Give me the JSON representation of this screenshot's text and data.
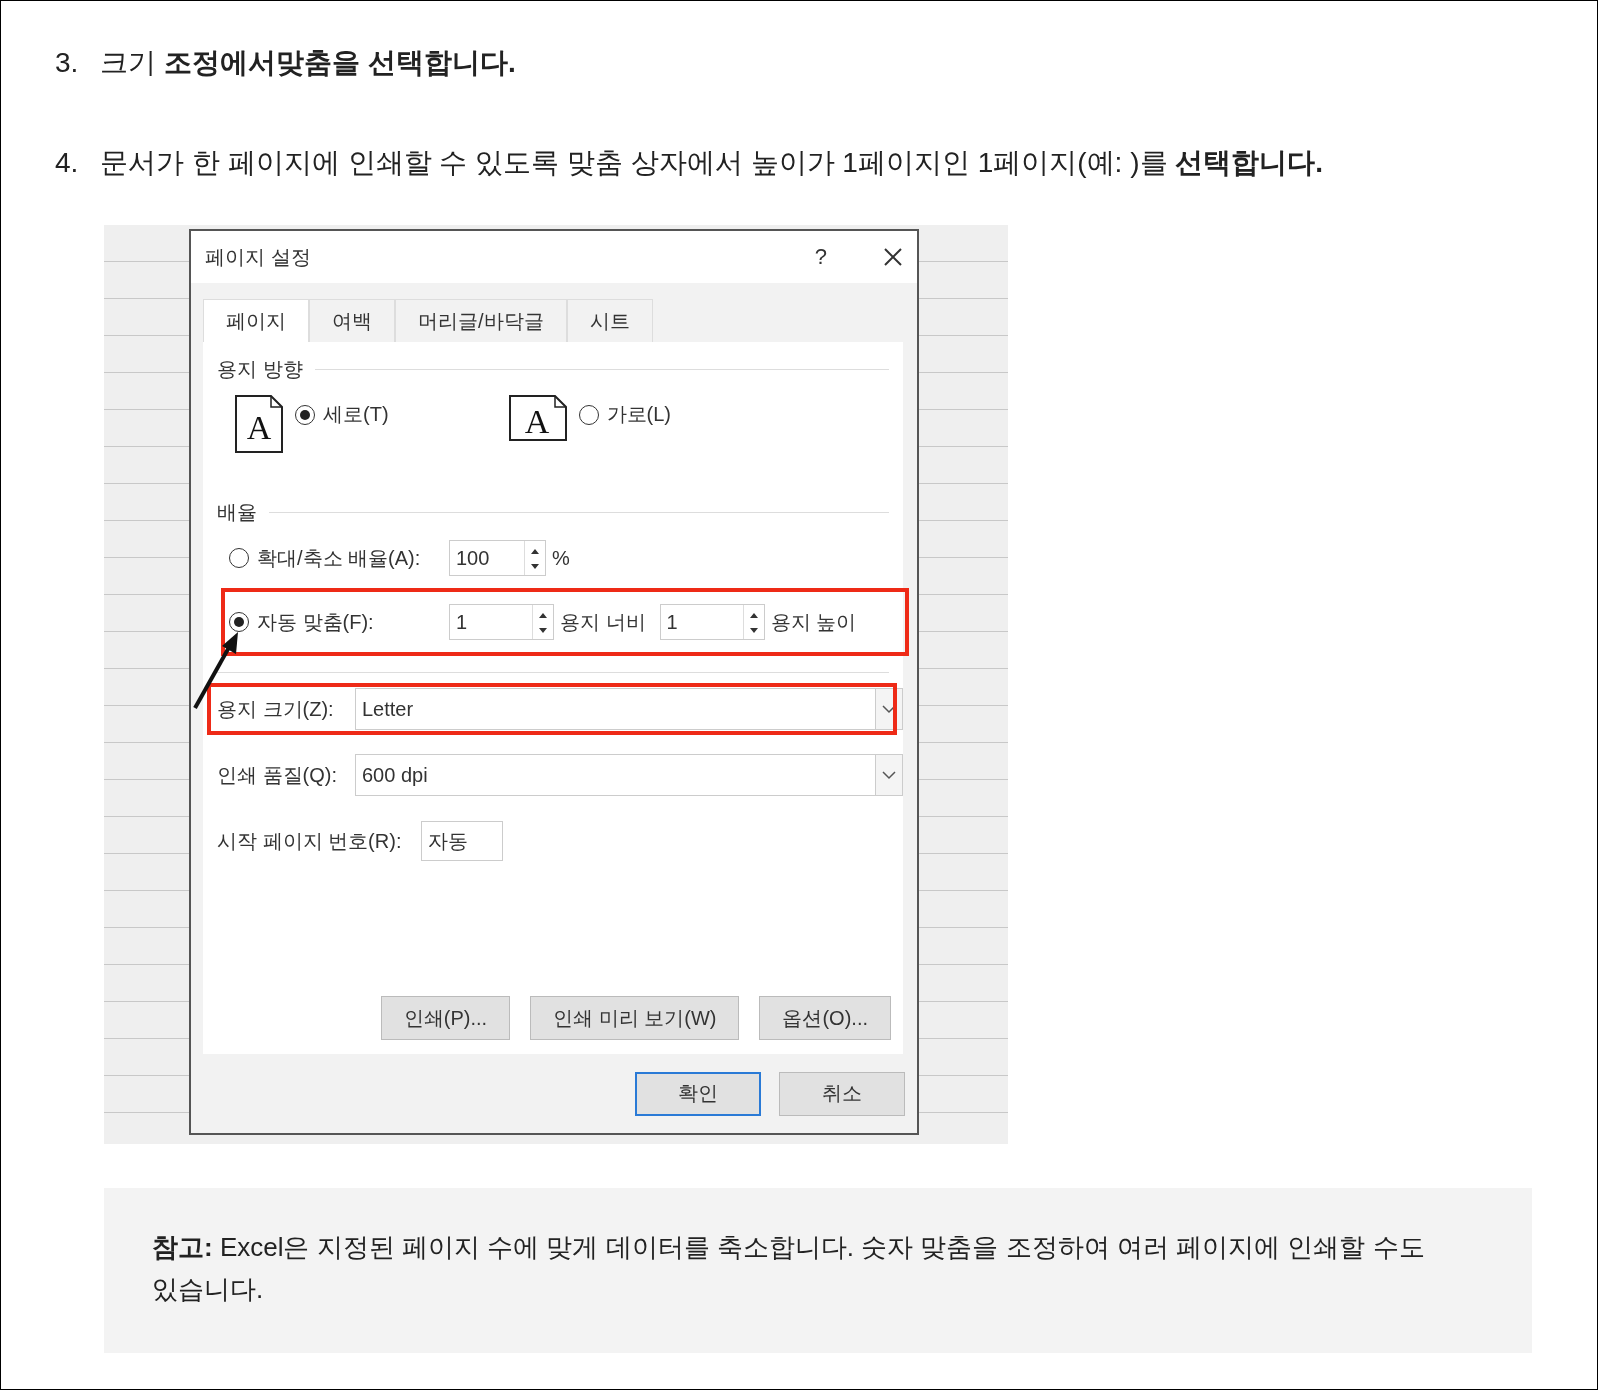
{
  "steps": [
    {
      "number": "3.",
      "text": "크기 **조정에서맞춤을 선택합니다.**"
    },
    {
      "number": "4.",
      "text": "문서가 한 페이지에 인쇄할 수 있도록 맞춤 상자에서 높이가 1페이지인 1페이지(예: )를 **선택합니다.**"
    }
  ],
  "dialog": {
    "title": "페이지 설정",
    "help": "?",
    "tabs": [
      {
        "label": "페이지",
        "selected": true
      },
      {
        "label": "여백",
        "selected": false
      },
      {
        "label": "머리글/바닥글",
        "selected": false
      },
      {
        "label": "시트",
        "selected": false
      }
    ],
    "orientation": {
      "label": "용지 방향",
      "options": [
        {
          "kind": "portrait",
          "icon_text": "A",
          "label": "세로(T)",
          "selected": true
        },
        {
          "kind": "landscape",
          "icon_text": "A",
          "label": "가로(L)",
          "selected": false
        }
      ]
    },
    "scaling": {
      "label": "배율",
      "rows": [
        {
          "kind": "percent",
          "label": "확대/축소 배율(A):",
          "selected": false,
          "highlighted": false,
          "value": "100",
          "unit": "%"
        },
        {
          "kind": "fit",
          "label": "자동 맞춤(F):",
          "selected": true,
          "highlighted": true,
          "width_value": "1",
          "width_label": "용지 너비",
          "height_value": "1",
          "height_label": "용지 높이"
        }
      ]
    },
    "fields": [
      {
        "kind": "dropdown",
        "label": "용지 크기(Z):",
        "value": "Letter",
        "highlighted": true
      },
      {
        "kind": "dropdown",
        "label": "인쇄 품질(Q):",
        "value": "600 dpi",
        "highlighted": false
      },
      {
        "kind": "text",
        "label": "시작 페이지 번호(R):",
        "value": "자동",
        "highlighted": false
      }
    ],
    "panel_buttons": [
      "인쇄(P)...",
      "인쇄 미리 보기(W)",
      "옵션(O)..."
    ],
    "footer_buttons": [
      {
        "label": "확인",
        "default": true
      },
      {
        "label": "취소",
        "default": false
      }
    ]
  },
  "note": {
    "text": "**참고:** Excel은 지정된 페이지 수에 맞게 데이터를 축소합니다. 숫자 맞춤을 조정하여 여러 페이지에 인쇄할 수도 있습니다."
  }
}
